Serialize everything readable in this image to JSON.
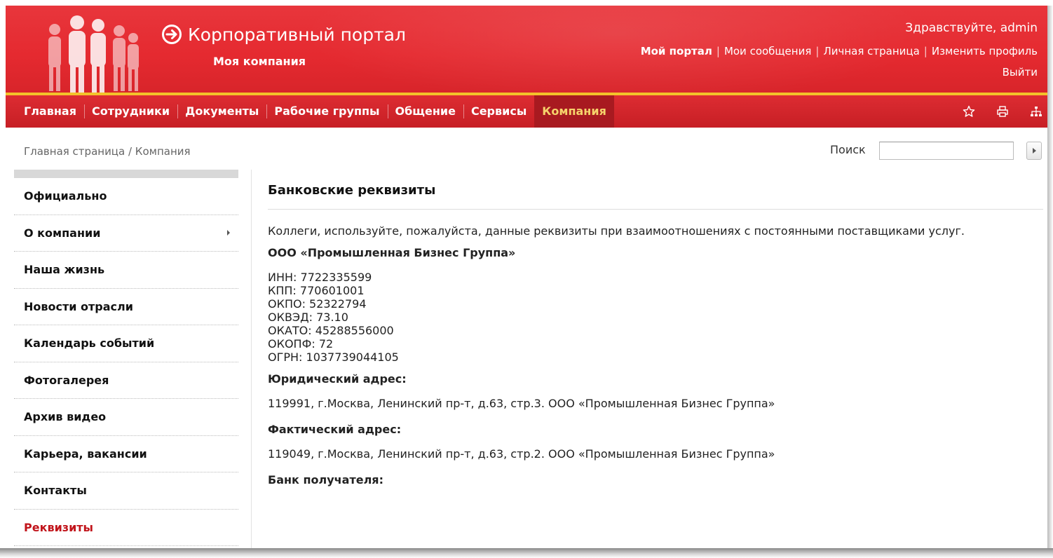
{
  "header": {
    "portal_title": "Корпоративный портал",
    "company": "Моя компания",
    "greeting": "Здравствуйте, admin",
    "links": [
      "Мой портал",
      "Мои сообщения",
      "Личная страница",
      "Изменить профиль"
    ],
    "logout": "Выйти",
    "brand_color": "#e52a30",
    "accent_color": "#f3c22a"
  },
  "nav": {
    "items": [
      "Главная",
      "Сотрудники",
      "Документы",
      "Рабочие группы",
      "Общение",
      "Сервисы",
      "Компания"
    ],
    "active": "Компания",
    "icons": [
      "star-icon",
      "print-icon",
      "sitemap-icon"
    ]
  },
  "breadcrumb": "Главная страница / Компания",
  "search": {
    "label": "Поиск",
    "value": ""
  },
  "sidebar": {
    "items": [
      "Официально",
      "О компании",
      "Наша жизнь",
      "Новости отрасли",
      "Календарь событий",
      "Фотогалерея",
      "Архив видео",
      "Карьера, вакансии",
      "Контакты",
      "Реквизиты"
    ],
    "active": "Реквизиты"
  },
  "content": {
    "title": "Банковские реквизиты",
    "intro": "Коллеги, используйте, пожалуйста, данные реквизиты при взаимоотношениях с постоянными поставщиками услуг.",
    "company_name": "ООО «Промышленная Бизнес Группа»",
    "requisites": [
      "ИНН: 7722335599",
      "КПП: 770601001",
      "ОКПО: 52322794",
      "ОКВЭД: 73.10",
      "ОКАТО: 45288556000",
      "ОКОПФ: 72",
      "ОГРН: 1037739044105"
    ],
    "legal_address_label": "Юридический адрес:",
    "legal_address": "119991, г.Москва, Ленинский пр-т, д.63, стр.3. ООО «Промышленная Бизнес Группа»",
    "actual_address_label": "Фактический адрес:",
    "actual_address": "119049, г.Москва, Ленинский пр-т, д.63, стр.2. ООО «Промышленная Бизнес Группа»",
    "bank_label": "Банк получателя:"
  }
}
